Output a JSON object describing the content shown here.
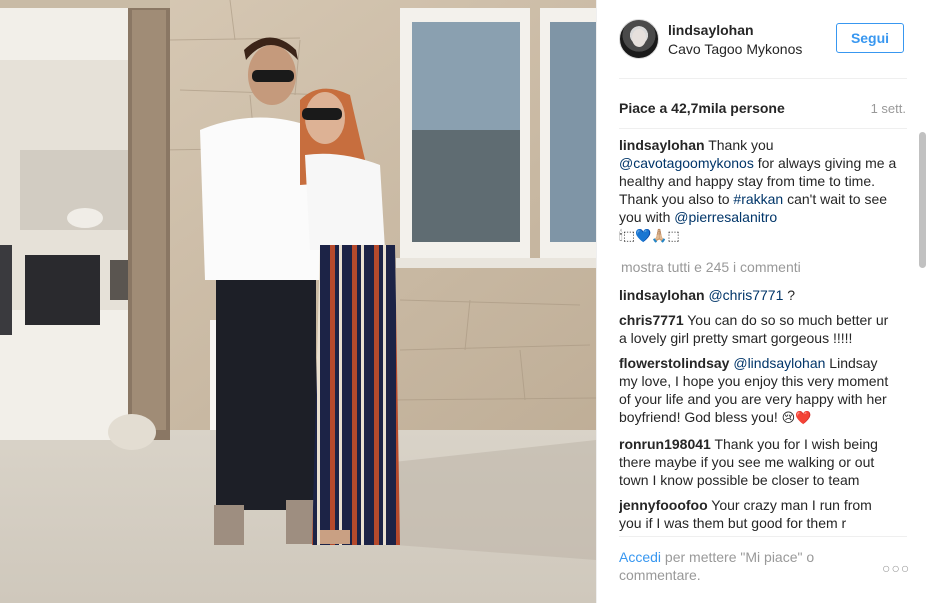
{
  "post": {
    "username": "lindsaylohan",
    "location": "Cavo Tagoo Mykonos",
    "follow_label": "Segui",
    "likes": "Piace a 42,7mila persone",
    "time": "1 sett."
  },
  "caption": {
    "user": "lindsaylohan",
    "t1": "Thank you",
    "m1": "@cavotagoomykonos",
    "t2": "for always giving me a healthy and happy stay from time to time. Thank you also to",
    "m2": "#rakkan",
    "t3": "can't wait to see you with",
    "m3": "@pierresalanitro",
    "emojis": "🕯⬚💙🙏🏼⬚"
  },
  "load_more": "mostra tutti e 245 i commenti",
  "comments": [
    {
      "user": "lindsaylohan",
      "mention": "@chris7771",
      "text": "?"
    },
    {
      "user": "chris7771",
      "text": "You can do so so much better ur a lovely girl pretty smart gorgeous !!!!!"
    },
    {
      "user": "flowerstolindsay",
      "mention": "@lindsaylohan",
      "text": "Lindsay my love, I hope you enjoy this very moment of your life and you are very happy with her boyfriend! God bless you!",
      "emoji": "😢❤️"
    },
    {
      "user": "ronrun198041",
      "text": "Thank you for I wish being there maybe if you see me walking or out town I know possible be closer to team"
    },
    {
      "user": "jennyfooofoo",
      "text": "Your crazy man I run from you if I was them but good for them r"
    }
  ],
  "footer": {
    "login": "Accedi",
    "text": "per mettere \"Mi piace\" o commentare.",
    "more_label": "○○○"
  },
  "colors": {
    "accent": "#3897f0",
    "mention": "#003569",
    "muted": "#999999"
  },
  "photo": {
    "icon": "photo-of-couple"
  }
}
